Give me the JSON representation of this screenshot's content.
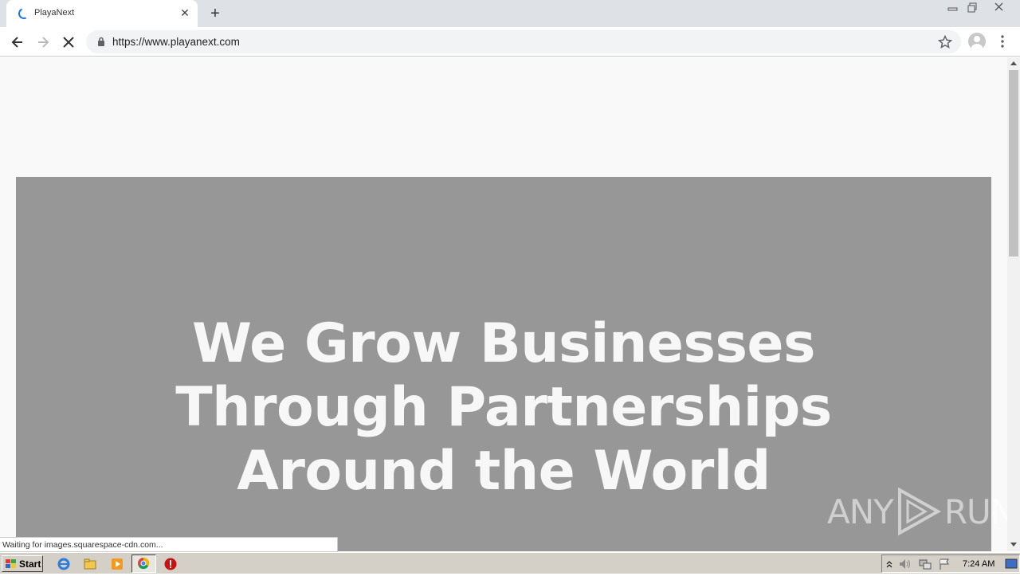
{
  "browser": {
    "tab_title": "PlayaNext",
    "url": "https://www.playanext.com",
    "status_text": "Waiting for images.squarespace-cdn.com..."
  },
  "page": {
    "headline_lines": [
      "We Grow Businesses",
      "Through Partnerships",
      "Around the World"
    ],
    "hero_color": "#979797",
    "watermark_left": "ANY",
    "watermark_right": "RUN"
  },
  "taskbar": {
    "start_label": "Start",
    "clock": "7:24 AM"
  },
  "colors": {
    "tab_strip": "#dee1e6",
    "accent": "#1a73e8"
  }
}
